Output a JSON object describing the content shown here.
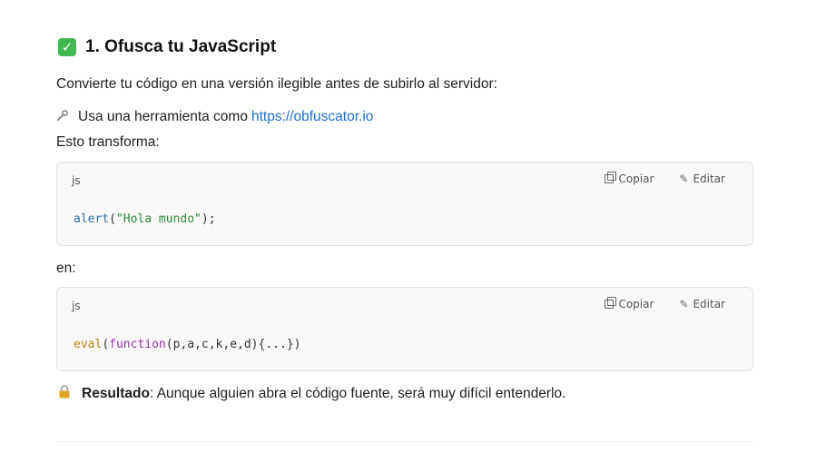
{
  "section": {
    "check_glyph": "✓",
    "title": "1. Ofusca tu JavaScript",
    "intro": "Convierte tu código en una versión ilegible antes de subirlo al servidor:",
    "tool_prefix": "Usa una herramienta como",
    "tool_link": "https://obfuscator.io",
    "transform_label": "Esto transforma:",
    "en_label": "en:",
    "result_label": "Resultado",
    "result_text": ": Aunque alguien abra el código fuente, será muy difícil entenderlo."
  },
  "code_blocks": [
    {
      "lang": "js",
      "copy_label": "Copiar",
      "edit_label": "Editar",
      "tokens": {
        "fn": "alert",
        "open": "(",
        "str": "\"Hola mundo\"",
        "close": ");"
      }
    },
    {
      "lang": "js",
      "copy_label": "Copiar",
      "edit_label": "Editar",
      "tokens": {
        "fn": "eval",
        "open": "(",
        "kw": "function",
        "rest": "(p,a,c,k,e,d){...})"
      }
    }
  ],
  "icons": {
    "check": "check-mark-icon",
    "tool": "wrench-icon",
    "lock": "lock-icon",
    "copy": "copy-icon",
    "edit": "pencil-icon"
  },
  "colors": {
    "check_bg": "#3fb950",
    "link": "#1a6fd6",
    "code_fn": "#2f6fb0",
    "code_string": "#2e8b3a",
    "code_eval": "#b8860b",
    "code_keyword": "#9b2fae"
  }
}
